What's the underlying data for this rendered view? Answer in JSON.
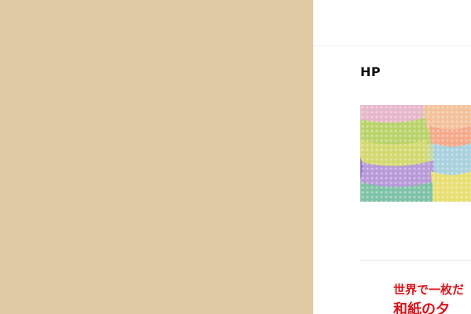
{
  "section": {
    "title": "HP"
  },
  "product_image": {
    "icon": "knit-towel-image"
  },
  "banner": {
    "line1": "世界で一枚だ",
    "line2": "和紙の夕"
  },
  "colors": {
    "left_background": "#dfc9a3",
    "right_background": "#ffffff",
    "banner_text": "#d8131b"
  }
}
